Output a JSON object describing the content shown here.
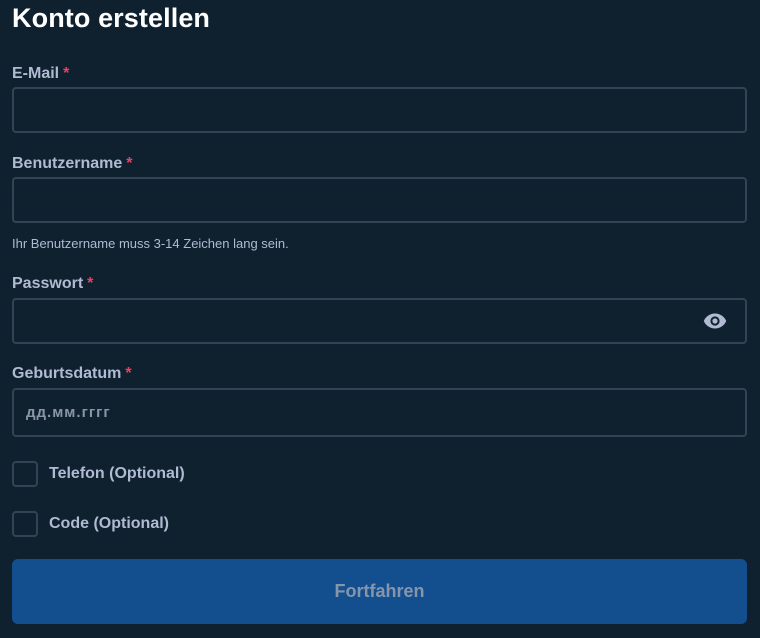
{
  "page": {
    "title": "Konto erstellen"
  },
  "form": {
    "required_marker": "*",
    "email": {
      "label": "E-Mail",
      "value": "",
      "placeholder": ""
    },
    "username": {
      "label": "Benutzername",
      "value": "",
      "placeholder": "",
      "hint": "Ihr Benutzername muss 3-14 Zeichen lang sein."
    },
    "password": {
      "label": "Passwort",
      "value": "",
      "placeholder": "",
      "toggle_icon": "eye-icon"
    },
    "birthdate": {
      "label": "Geburtsdatum",
      "value": "",
      "placeholder": "дд.мм.гггг"
    },
    "phone_option": {
      "label": "Telefon (Optional)",
      "checked": false
    },
    "code_option": {
      "label": "Code (Optional)",
      "checked": false
    },
    "submit": {
      "label": "Fortfahren",
      "enabled": false
    }
  },
  "colors": {
    "background": "#0f212e",
    "input_border": "#2f4553",
    "label": "#b1bad3",
    "required": "#ed4163",
    "button_bg": "#134f8f",
    "button_text": "#8596ac"
  }
}
